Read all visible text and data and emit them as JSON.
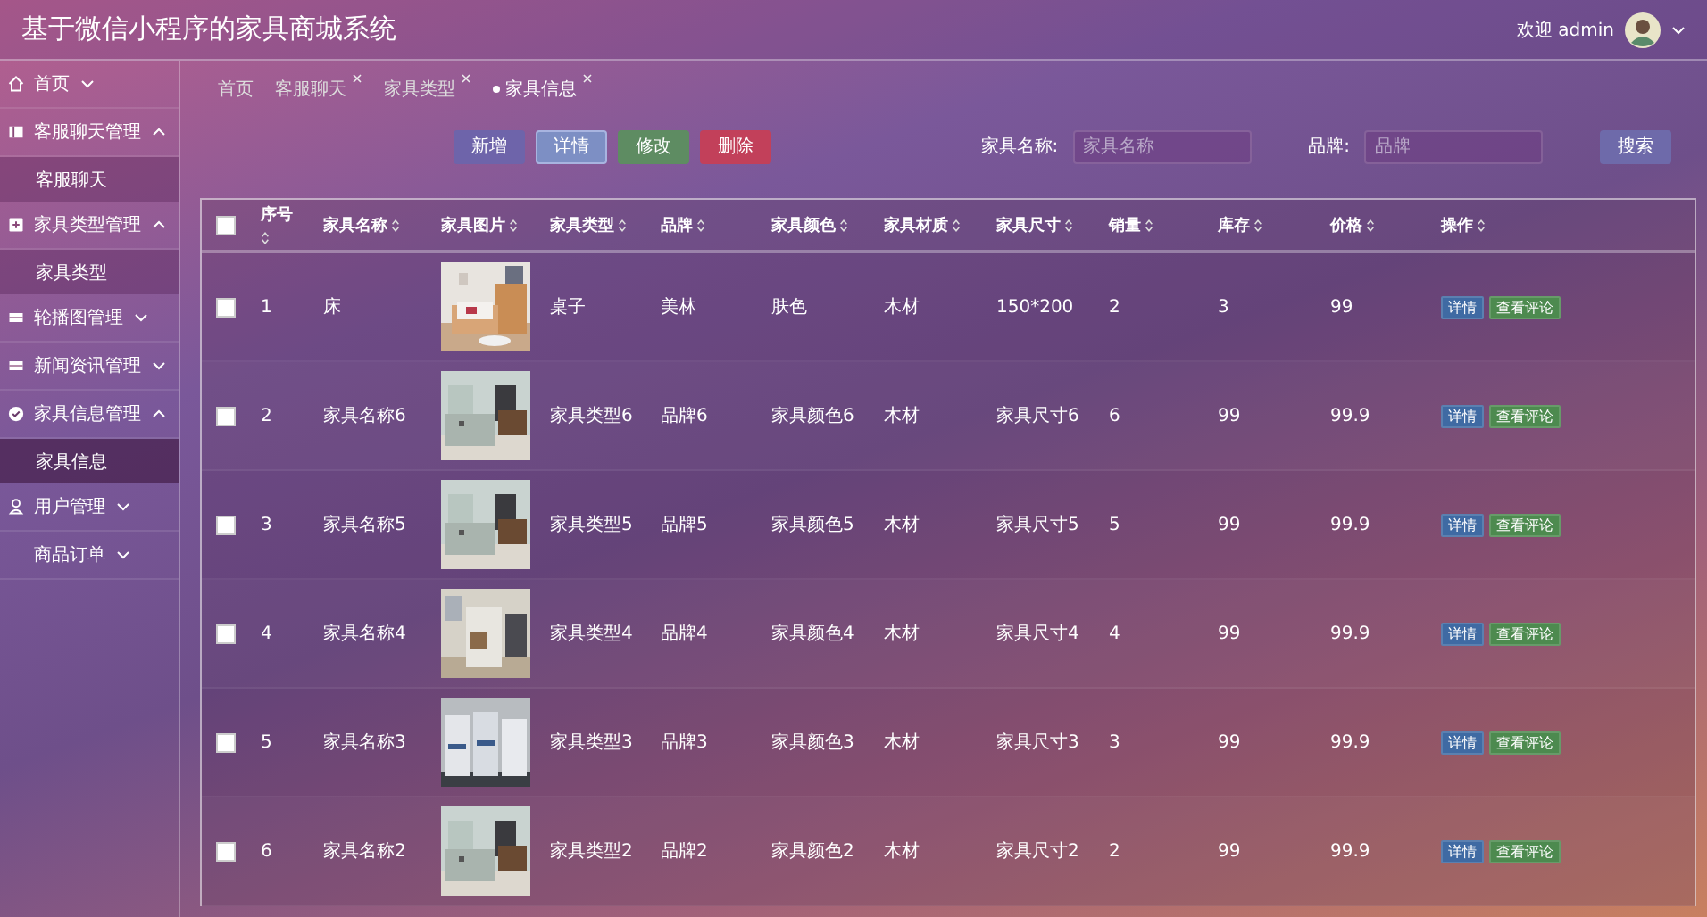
{
  "header": {
    "title": "基于微信小程序的家具商城系统",
    "welcome": "欢迎 admin"
  },
  "sidebar": {
    "items": [
      {
        "label": "首页",
        "expanded": false
      },
      {
        "label": "客服聊天管理",
        "expanded": true,
        "children": [
          {
            "label": "客服聊天",
            "selected": false
          }
        ]
      },
      {
        "label": "家具类型管理",
        "expanded": true,
        "children": [
          {
            "label": "家具类型",
            "selected": false
          }
        ]
      },
      {
        "label": "轮播图管理",
        "expanded": false
      },
      {
        "label": "新闻资讯管理",
        "expanded": false
      },
      {
        "label": "家具信息管理",
        "expanded": true,
        "children": [
          {
            "label": "家具信息",
            "selected": true
          }
        ]
      },
      {
        "label": "用户管理",
        "expanded": false
      },
      {
        "label": "商品订单",
        "expanded": false
      }
    ]
  },
  "tabs": [
    {
      "label": "首页",
      "selected": false,
      "closable": false
    },
    {
      "label": "客服聊天",
      "selected": false,
      "closable": true
    },
    {
      "label": "家具类型",
      "selected": false,
      "closable": true
    },
    {
      "label": "家具信息",
      "selected": true,
      "closable": true
    }
  ],
  "toolbar": {
    "buttons": [
      {
        "label": "新增",
        "kind": "add"
      },
      {
        "label": "详情",
        "kind": "detail"
      },
      {
        "label": "修改",
        "kind": "edit"
      },
      {
        "label": "删除",
        "kind": "delete"
      }
    ],
    "filters": [
      {
        "label": "家具名称:",
        "placeholder": "家具名称"
      },
      {
        "label": "品牌:",
        "placeholder": "品牌"
      }
    ],
    "search_button": "搜索"
  },
  "table": {
    "select_all": false,
    "columns": [
      "序号",
      "家具名称",
      "家具图片",
      "家具类型",
      "品牌",
      "家具颜色",
      "家具材质",
      "家具尺寸",
      "销量",
      "库存",
      "价格",
      "操作"
    ],
    "rows": [
      {
        "checked": false,
        "no": "1",
        "name": "床",
        "type": "桌子",
        "brand": "美林",
        "furniture_color": "肤色",
        "material": "木材",
        "size": "150*200",
        "sales": "2",
        "stock": "3",
        "price": "99",
        "actions": [
          "详情",
          "查看评论"
        ]
      },
      {
        "checked": false,
        "no": "2",
        "name": "家具名称6",
        "type": "家具类型6",
        "brand": "品牌6",
        "furniture_color": "家具颜色6",
        "material": "木材",
        "size": "家具尺寸6",
        "sales": "6",
        "stock": "99",
        "price": "99.9",
        "actions": [
          "详情",
          "查看评论"
        ]
      },
      {
        "checked": false,
        "no": "3",
        "name": "家具名称5",
        "type": "家具类型5",
        "brand": "品牌5",
        "furniture_color": "家具颜色5",
        "material": "木材",
        "size": "家具尺寸5",
        "sales": "5",
        "stock": "99",
        "price": "99.9",
        "actions": [
          "详情",
          "查看评论"
        ]
      },
      {
        "checked": false,
        "no": "4",
        "name": "家具名称4",
        "type": "家具类型4",
        "brand": "品牌4",
        "furniture_color": "家具颜色4",
        "material": "木材",
        "size": "家具尺寸4",
        "sales": "4",
        "stock": "99",
        "price": "99.9",
        "actions": [
          "详情",
          "查看评论"
        ]
      },
      {
        "checked": false,
        "no": "5",
        "name": "家具名称3",
        "type": "家具类型3",
        "brand": "品牌3",
        "furniture_color": "家具颜色3",
        "material": "木材",
        "size": "家具尺寸3",
        "sales": "3",
        "stock": "99",
        "price": "99.9",
        "actions": [
          "详情",
          "查看评论"
        ]
      },
      {
        "checked": false,
        "no": "6",
        "name": "家具名称2",
        "type": "家具类型2",
        "brand": "品牌2",
        "furniture_color": "家具颜色2",
        "material": "木材",
        "size": "家具尺寸2",
        "sales": "2",
        "stock": "99",
        "price": "99.9",
        "actions": [
          "详情",
          "查看评论"
        ]
      }
    ]
  }
}
